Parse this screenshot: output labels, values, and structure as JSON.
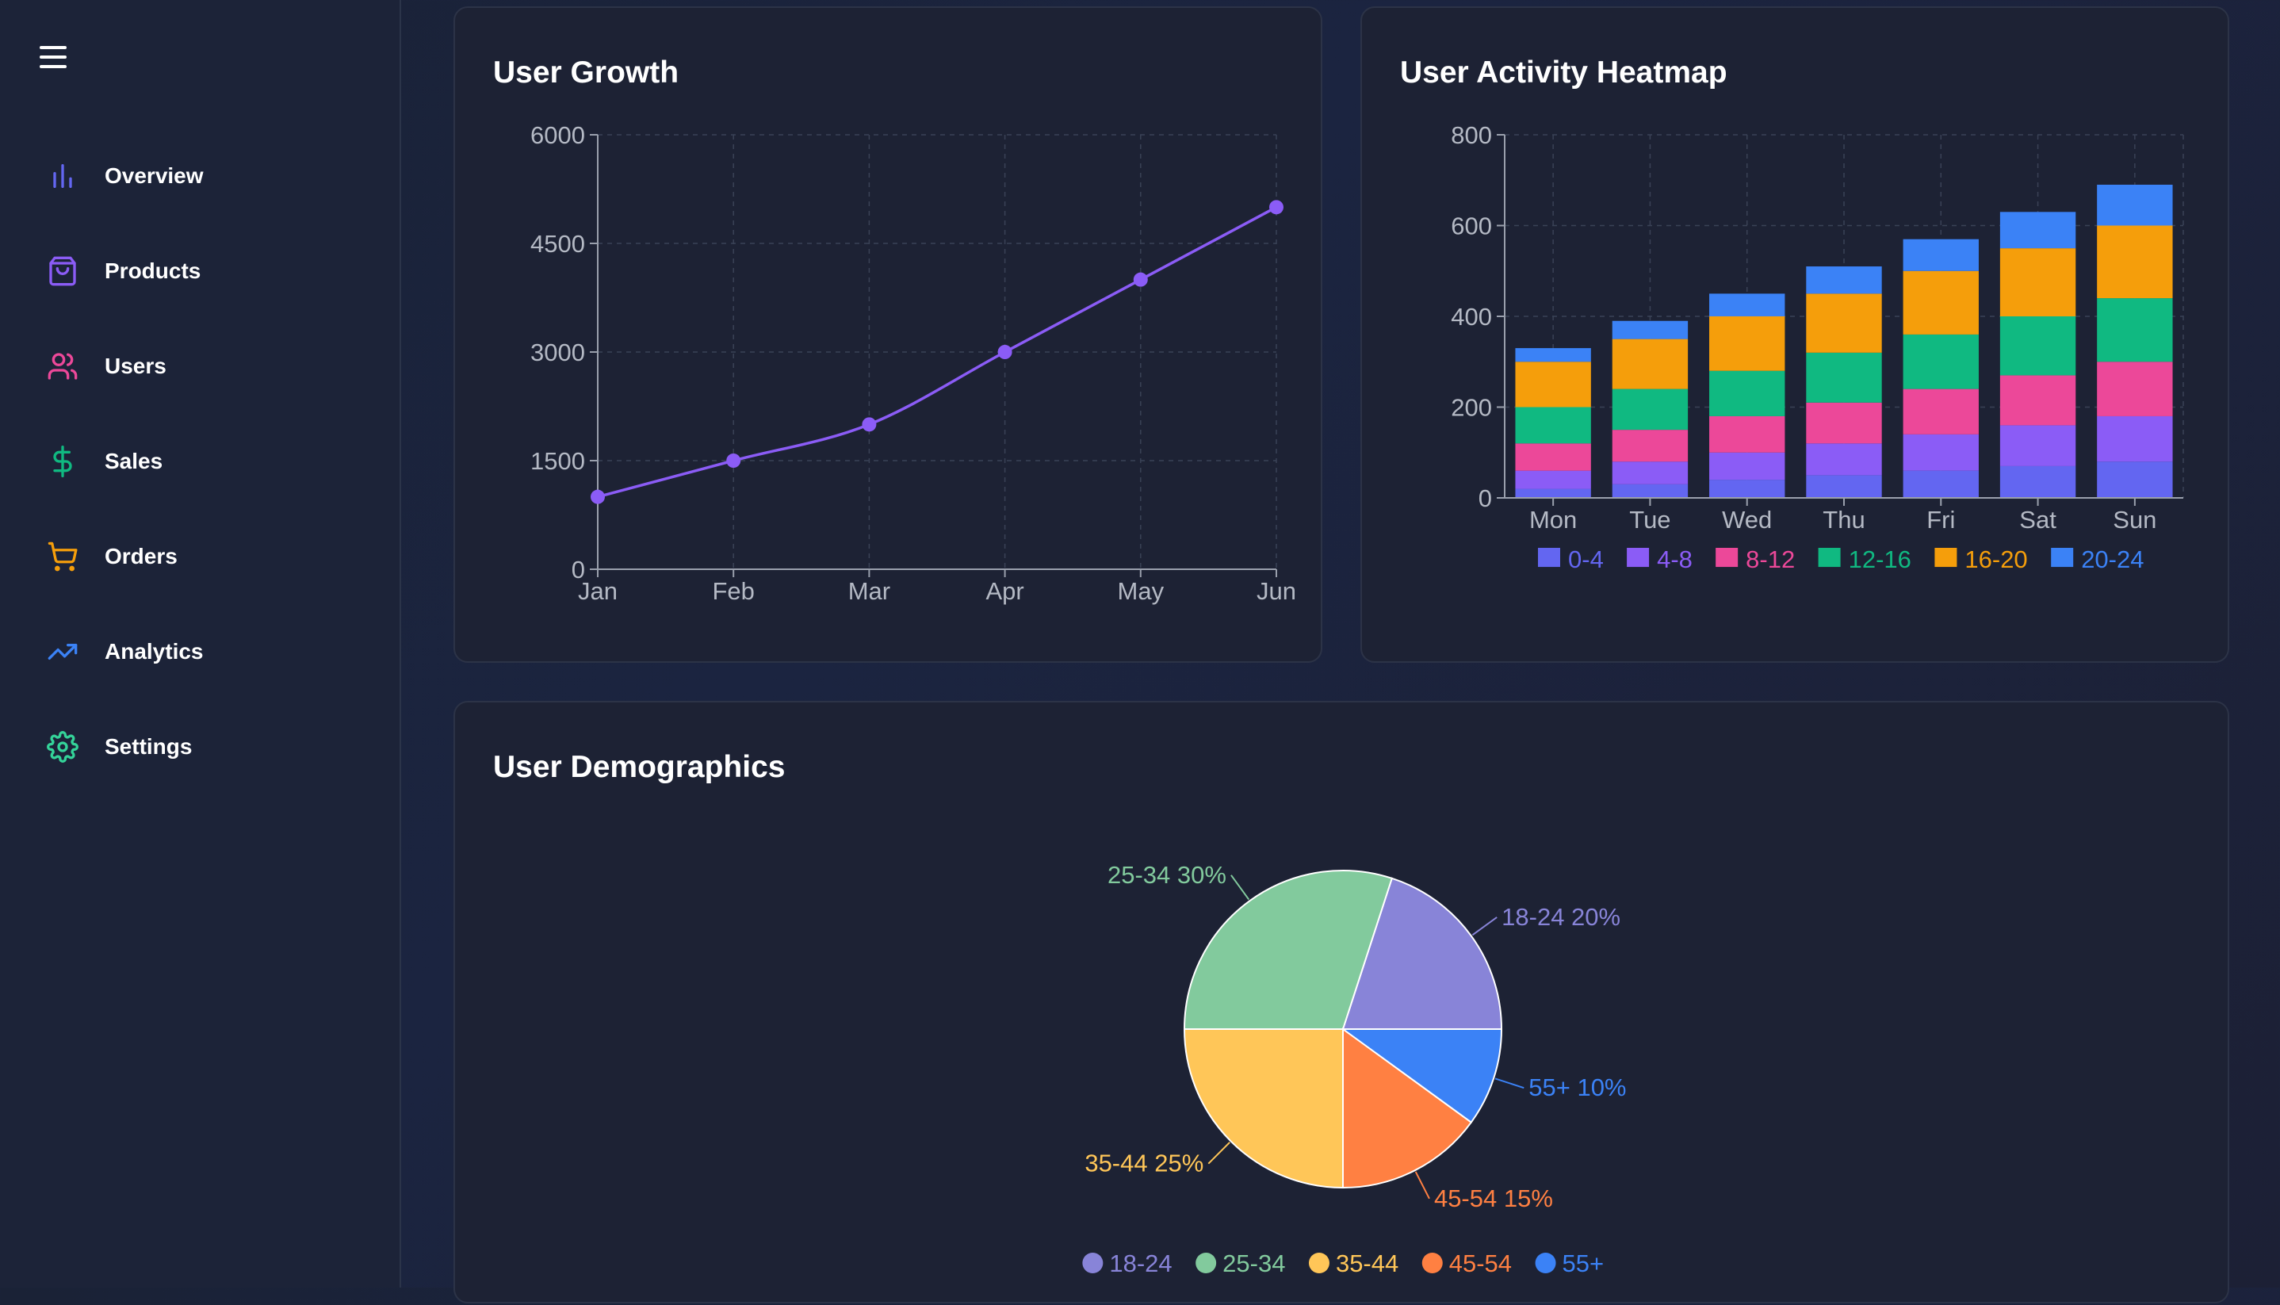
{
  "sidebar": {
    "menu_icon": "hamburger-menu-icon",
    "items": [
      {
        "label": "Overview",
        "icon": "bar-chart-icon",
        "color": "#6366f1"
      },
      {
        "label": "Products",
        "icon": "shopping-bag-icon",
        "color": "#8b5cf6"
      },
      {
        "label": "Users",
        "icon": "users-icon",
        "color": "#ec4899"
      },
      {
        "label": "Sales",
        "icon": "dollar-sign-icon",
        "color": "#10b981"
      },
      {
        "label": "Orders",
        "icon": "shopping-cart-icon",
        "color": "#f59e0b"
      },
      {
        "label": "Analytics",
        "icon": "trending-up-icon",
        "color": "#3b82f6"
      },
      {
        "label": "Settings",
        "icon": "gear-icon",
        "color": "#34d399"
      }
    ]
  },
  "cards": {
    "growth_title": "User Growth",
    "heatmap_title": "User Activity Heatmap",
    "demographics_title": "User Demographics"
  },
  "chart_data": [
    {
      "type": "line",
      "title": "User Growth",
      "x": [
        "Jan",
        "Feb",
        "Mar",
        "Apr",
        "May",
        "Jun"
      ],
      "series": [
        {
          "values": [
            1000,
            1500,
            2000,
            3000,
            4000,
            5000
          ],
          "color": "#8b5cf6"
        }
      ],
      "ylim": [
        0,
        6000
      ],
      "yticks": [
        0,
        1500,
        3000,
        4500,
        6000
      ],
      "grid": true
    },
    {
      "type": "bar",
      "stacked": true,
      "title": "User Activity Heatmap",
      "categories": [
        "Mon",
        "Tue",
        "Wed",
        "Thu",
        "Fri",
        "Sat",
        "Sun"
      ],
      "series": [
        {
          "name": "0-4",
          "color": "#6366f1",
          "values": [
            20,
            30,
            40,
            50,
            60,
            70,
            80
          ]
        },
        {
          "name": "4-8",
          "color": "#8b5cf6",
          "values": [
            40,
            50,
            60,
            70,
            80,
            90,
            100
          ]
        },
        {
          "name": "8-12",
          "color": "#ec4899",
          "values": [
            60,
            70,
            80,
            90,
            100,
            110,
            120
          ]
        },
        {
          "name": "12-16",
          "color": "#10b981",
          "values": [
            80,
            90,
            100,
            110,
            120,
            130,
            140
          ]
        },
        {
          "name": "16-20",
          "color": "#f59e0b",
          "values": [
            100,
            110,
            120,
            130,
            140,
            150,
            160
          ]
        },
        {
          "name": "20-24",
          "color": "#3b82f6",
          "values": [
            30,
            40,
            50,
            60,
            70,
            80,
            90
          ]
        }
      ],
      "ylim": [
        0,
        800
      ],
      "yticks": [
        0,
        200,
        400,
        600,
        800
      ],
      "legend": "bottom",
      "grid": true
    },
    {
      "type": "pie",
      "title": "User Demographics",
      "slices": [
        {
          "label": "18-24",
          "value": 20,
          "color": "#8884d8"
        },
        {
          "label": "25-34",
          "value": 30,
          "color": "#82ca9d"
        },
        {
          "label": "35-44",
          "value": 25,
          "color": "#ffc658"
        },
        {
          "label": "45-54",
          "value": 15,
          "color": "#ff8042"
        },
        {
          "label": "55+",
          "value": 10,
          "color": "#3b82f6"
        }
      ],
      "legend": "bottom"
    }
  ]
}
